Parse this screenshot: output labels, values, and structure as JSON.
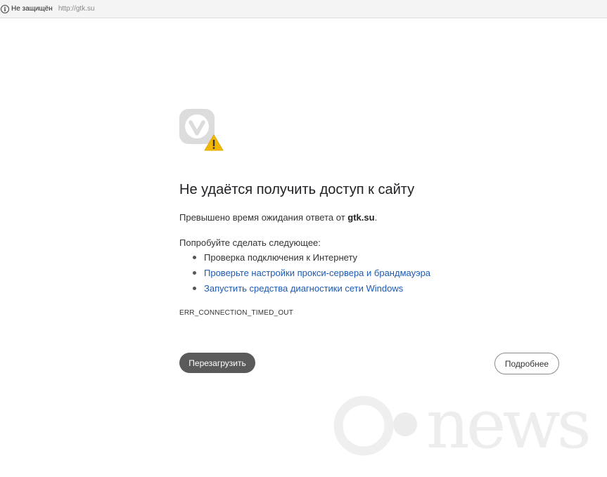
{
  "address_bar": {
    "security_label": "Не защищён",
    "url": "http://gtk.su"
  },
  "error": {
    "heading": "Не удаётся получить доступ к сайту",
    "description_prefix": "Превышено время ожидания ответа от ",
    "domain": "gtk.su",
    "description_suffix": ".",
    "suggestions_title": "Попробуйте сделать следующее:",
    "suggestions": [
      "Проверка подключения к Интернету",
      "Проверьте настройки прокси-сервера и брандмауэра",
      "Запустить средства диагностики сети Windows"
    ],
    "code": "ERR_CONNECTION_TIMED_OUT"
  },
  "buttons": {
    "reload": "Перезагрузить",
    "details": "Подробнее"
  },
  "watermark": "cnews",
  "colors": {
    "link": "#1a5ab6",
    "reload_button_bg": "#5a5a5a",
    "warning": "#f2b705",
    "logo_gray": "#dcdcdc"
  },
  "icons": {
    "address_info": "info-icon",
    "logo": "vivaldi-logo-icon",
    "warning": "warning-triangle-icon"
  }
}
